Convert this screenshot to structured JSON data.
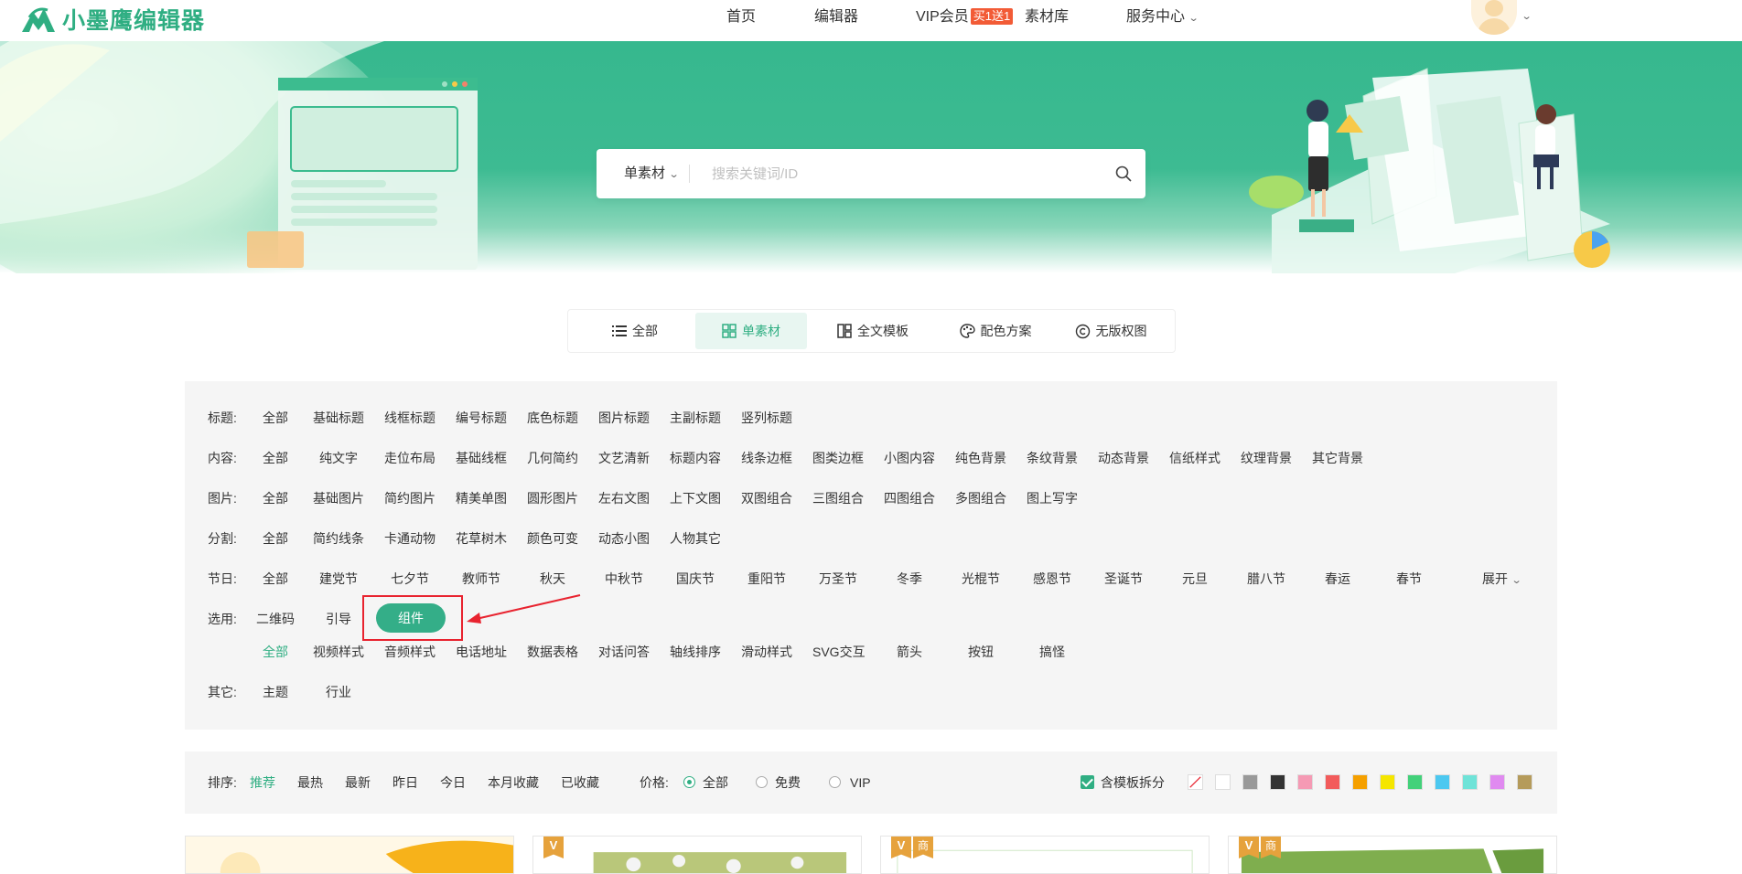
{
  "brand": {
    "name": "小墨鹰编辑器",
    "color": "#2fae82"
  },
  "nav": {
    "home": "首页",
    "editor": "编辑器",
    "vip": "VIP会员",
    "vip_badge": "买1送1",
    "materials": "素材库",
    "service": "服务中心"
  },
  "search": {
    "type_label": "单素材",
    "placeholder": "搜索关键词/ID"
  },
  "tabs": [
    {
      "label": "全部",
      "icon": "list-icon",
      "active": false
    },
    {
      "label": "单素材",
      "icon": "grid-icon",
      "active": true
    },
    {
      "label": "全文模板",
      "icon": "layout-icon",
      "active": false
    },
    {
      "label": "配色方案",
      "icon": "palette-icon",
      "active": false
    },
    {
      "label": "无版权图",
      "icon": "copyright-icon",
      "active": false
    }
  ],
  "filters": {
    "title": {
      "label": "标题:",
      "items": [
        "全部",
        "基础标题",
        "线框标题",
        "编号标题",
        "底色标题",
        "图片标题",
        "主副标题",
        "竖列标题"
      ]
    },
    "content": {
      "label": "内容:",
      "items": [
        "全部",
        "纯文字",
        "走位布局",
        "基础线框",
        "几何简约",
        "文艺清新",
        "标题内容",
        "线条边框",
        "图类边框",
        "小图内容",
        "纯色背景",
        "条纹背景",
        "动态背景",
        "信纸样式",
        "纹理背景",
        "其它背景"
      ]
    },
    "image": {
      "label": "图片:",
      "items": [
        "全部",
        "基础图片",
        "简约图片",
        "精美单图",
        "圆形图片",
        "左右文图",
        "上下文图",
        "双图组合",
        "三图组合",
        "四图组合",
        "多图组合",
        "图上写字"
      ]
    },
    "divider": {
      "label": "分割:",
      "items": [
        "全部",
        "简约线条",
        "卡通动物",
        "花草树木",
        "颜色可变",
        "动态小图",
        "人物其它"
      ]
    },
    "festival": {
      "label": "节日:",
      "items": [
        "全部",
        "建党节",
        "七夕节",
        "教师节",
        "秋天",
        "中秋节",
        "国庆节",
        "重阳节",
        "万圣节",
        "冬季",
        "光棍节",
        "感恩节",
        "圣诞节",
        "元旦",
        "腊八节",
        "春运",
        "春节"
      ],
      "expand": "展开"
    },
    "select": {
      "label": "选用:",
      "items": [
        "二维码",
        "引导",
        "组件"
      ],
      "active": "组件"
    },
    "component_sub": {
      "items": [
        "全部",
        "视频样式",
        "音频样式",
        "电话地址",
        "数据表格",
        "对话问答",
        "轴线排序",
        "滑动样式",
        "SVG交互",
        "箭头",
        "按钮",
        "搞怪"
      ],
      "active": "全部"
    },
    "other": {
      "label": "其它:",
      "items": [
        "主题",
        "行业"
      ]
    }
  },
  "sort": {
    "label": "排序:",
    "items": [
      "推荐",
      "最热",
      "最新",
      "昨日",
      "今日",
      "本月收藏",
      "已收藏"
    ],
    "active": "推荐",
    "price_label": "价格:",
    "price_options": [
      "全部",
      "免费",
      "VIP"
    ],
    "price_selected": "全部",
    "split_label": "含模板拆分",
    "split_checked": true,
    "swatches": [
      "none",
      "#ffffff",
      "#999999",
      "#333333",
      "#f59ab4",
      "#f25b5b",
      "#f5a000",
      "#f5e600",
      "#43d17a",
      "#4cc8f0",
      "#6fe3d8",
      "#e08af0",
      "#b59b5b"
    ]
  },
  "cards": [
    {
      "badges": []
    },
    {
      "badges": [
        "V"
      ]
    },
    {
      "badges": [
        "V",
        "商"
      ]
    },
    {
      "badges": [
        "V",
        "商"
      ]
    }
  ]
}
